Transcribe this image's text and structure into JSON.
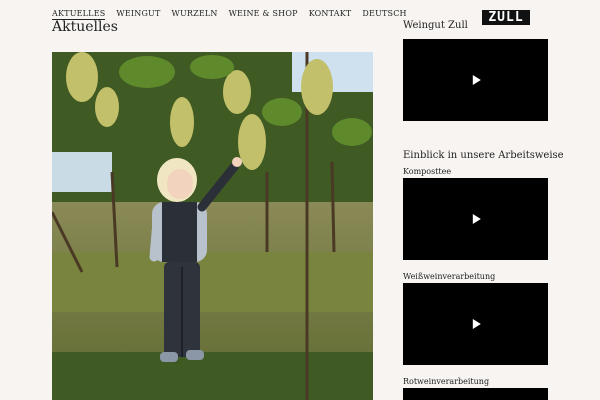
{
  "nav": {
    "items": [
      "AKTUELLES",
      "WEINGUT",
      "WURZELN",
      "WEINE & SHOP",
      "KONTAKT",
      "DEUTSCH"
    ]
  },
  "logo": "ZULL",
  "page": {
    "title": "Aktuelles"
  },
  "sidebar": {
    "heading1": "Weingut Zull",
    "heading2": "Einblick in unsere Arbeitsweise",
    "videos": [
      "Komposttee",
      "Weißweinverarbeitung",
      "Rotweinverarbeitung"
    ]
  },
  "icons": {
    "play": "play-icon"
  },
  "colors": {
    "background": "#f7f4f1",
    "video": "#000000"
  }
}
